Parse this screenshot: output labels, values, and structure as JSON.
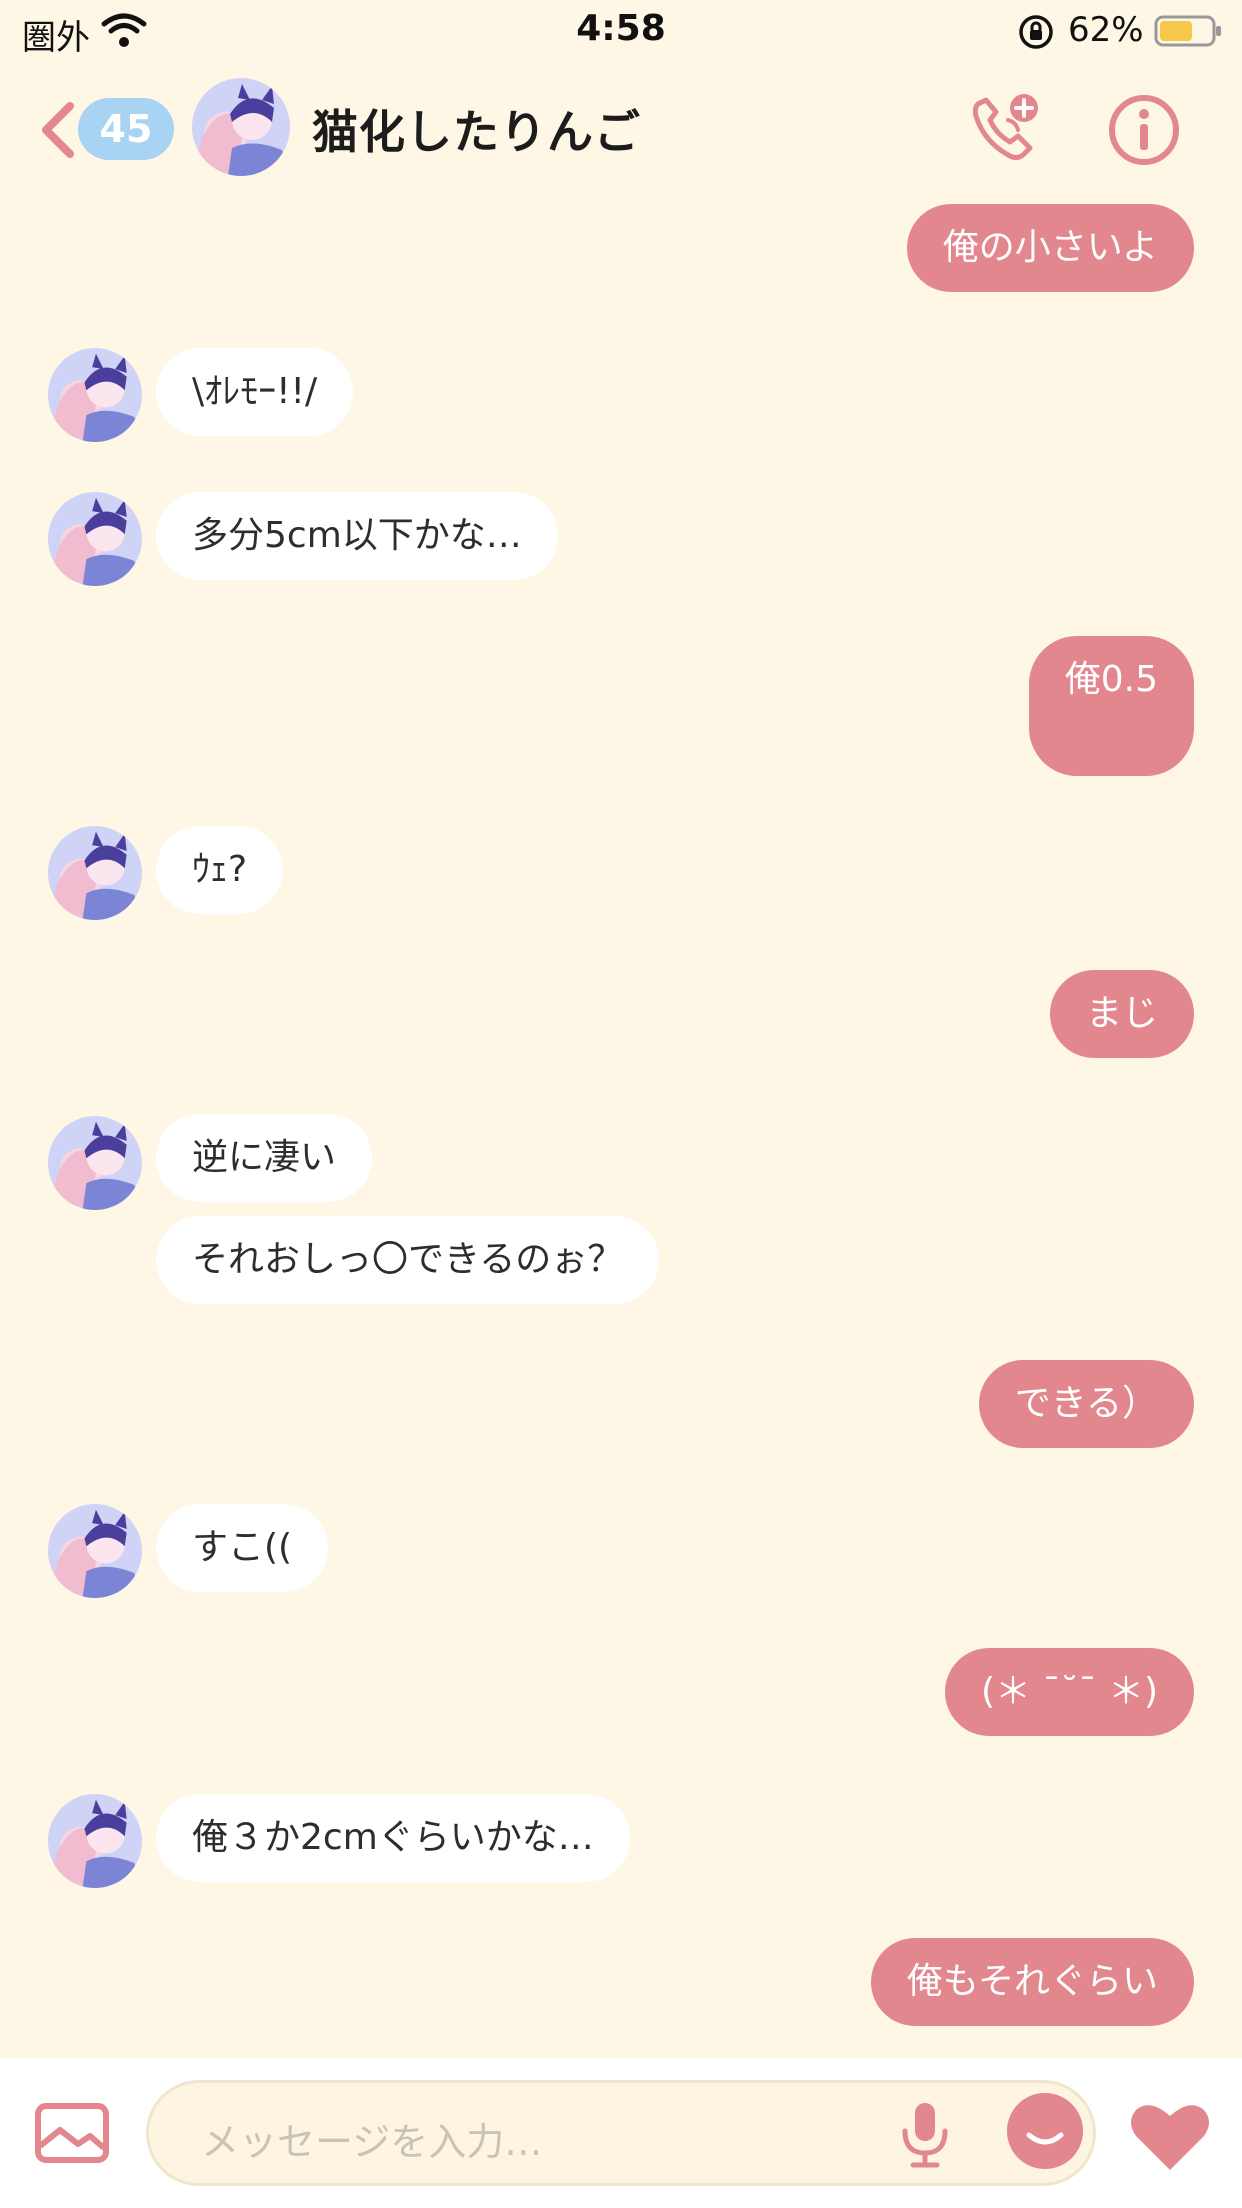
{
  "status_bar": {
    "carrier": "圏外",
    "time": "4:58",
    "battery_percent": "62%"
  },
  "header": {
    "unread_count": "45",
    "contact_name": "猫化したりんご"
  },
  "colors": {
    "background": "#fef7e6",
    "outgoing_bubble": "#e2878e",
    "incoming_bubble": "#ffffff",
    "accent": "#e2878e",
    "badge": "#a8d3f2"
  },
  "messages": [
    {
      "dir": "out",
      "text": "俺の小さいよ"
    },
    {
      "dir": "in",
      "text": "\\ｵﾚﾓｰ!!/"
    },
    {
      "dir": "in",
      "text": "多分5cm以下かな…"
    },
    {
      "dir": "out",
      "text": "俺0.5"
    },
    {
      "dir": "in",
      "text": "ｳｪ?"
    },
    {
      "dir": "out",
      "text": "まじ"
    },
    {
      "dir": "in",
      "text": "逆に凄い"
    },
    {
      "dir": "in",
      "text": "それおしっ〇できるのぉ？"
    },
    {
      "dir": "out",
      "text": "できる）"
    },
    {
      "dir": "in",
      "text": "すこ(("
    },
    {
      "dir": "out",
      "text": "(＊ ˉ˘ˉ ＊)"
    },
    {
      "dir": "in",
      "text": "俺３か2cmぐらいかな…"
    },
    {
      "dir": "out",
      "text": "俺もそれぐらい"
    }
  ],
  "input": {
    "placeholder": "メッセージを入力…"
  },
  "icons": {
    "back": "chevron-left-icon",
    "call": "phone-add-icon",
    "info": "info-icon",
    "gallery": "image-gallery-icon",
    "mic": "microphone-icon",
    "emoji": "emoji-icon",
    "like": "heart-icon"
  }
}
